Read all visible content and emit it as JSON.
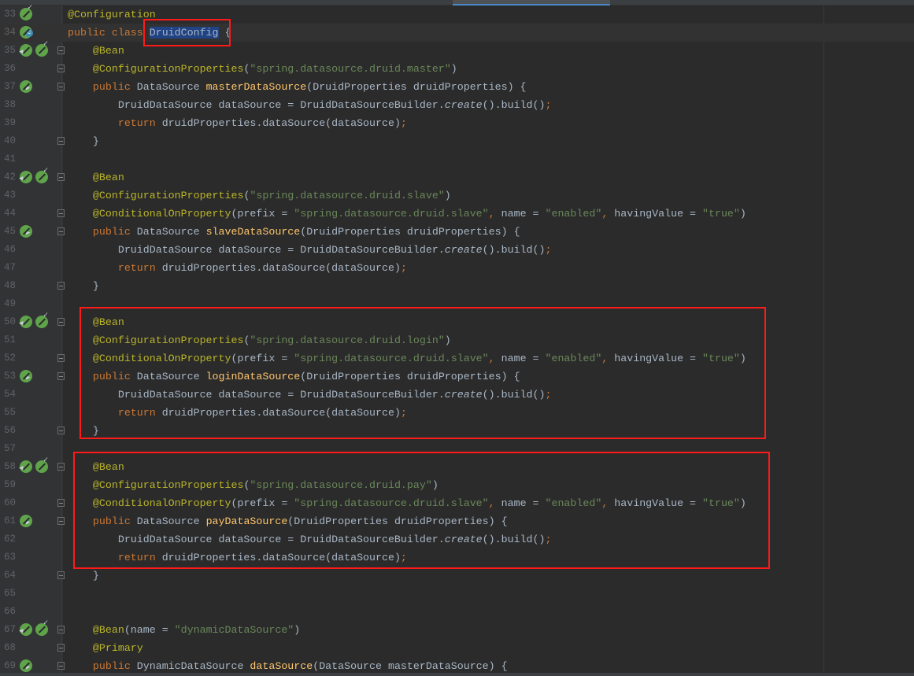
{
  "colors": {
    "keyword": "#cc7832",
    "annotation": "#bbb529",
    "string": "#6a8759",
    "text": "#a9b7c6",
    "method": "#ffc66d",
    "highlight_box": "#ff1a1a",
    "selection": "#214283"
  },
  "lines": [
    {
      "n": "33",
      "icons": [
        "bean-check"
      ],
      "fold": false,
      "tokens": [
        [
          "a",
          "@Configuration"
        ]
      ]
    },
    {
      "n": "34",
      "icons": [
        "bean-class"
      ],
      "fold": false,
      "current": true,
      "tokens": [
        [
          "k",
          "public class "
        ],
        [
          "sel",
          "DruidConfig"
        ],
        [
          "t",
          " {"
        ]
      ]
    },
    {
      "n": "35",
      "icons": [
        "bean-left",
        "bean-check"
      ],
      "fold": true,
      "tokens": [
        [
          "t",
          "    "
        ],
        [
          "a",
          "@Bean"
        ]
      ]
    },
    {
      "n": "36",
      "icons": [],
      "fold": true,
      "tokens": [
        [
          "t",
          "    "
        ],
        [
          "a",
          "@ConfigurationProperties"
        ],
        [
          "t",
          "("
        ],
        [
          "s",
          "\"spring.datasource.druid.master\""
        ],
        [
          "t",
          ")"
        ]
      ]
    },
    {
      "n": "37",
      "icons": [
        "bean-right"
      ],
      "fold": true,
      "tokens": [
        [
          "t",
          "    "
        ],
        [
          "k",
          "public "
        ],
        [
          "t",
          "DataSource "
        ],
        [
          "m",
          "masterDataSource"
        ],
        [
          "t",
          "(DruidProperties druidProperties) {"
        ]
      ]
    },
    {
      "n": "38",
      "icons": [],
      "fold": false,
      "tokens": [
        [
          "t",
          "        DruidDataSource dataSource = DruidDataSourceBuilder."
        ],
        [
          "i",
          "create"
        ],
        [
          "t",
          "().build()"
        ],
        [
          "k",
          ";"
        ]
      ]
    },
    {
      "n": "39",
      "icons": [],
      "fold": false,
      "tokens": [
        [
          "t",
          "        "
        ],
        [
          "k",
          "return "
        ],
        [
          "t",
          "druidProperties.dataSource(dataSource)"
        ],
        [
          "k",
          ";"
        ]
      ]
    },
    {
      "n": "40",
      "icons": [],
      "fold": true,
      "tokens": [
        [
          "t",
          "    }"
        ]
      ]
    },
    {
      "n": "41",
      "icons": [],
      "fold": false,
      "tokens": []
    },
    {
      "n": "42",
      "icons": [
        "bean-left",
        "bean-check"
      ],
      "fold": true,
      "tokens": [
        [
          "t",
          "    "
        ],
        [
          "a",
          "@Bean"
        ]
      ]
    },
    {
      "n": "43",
      "icons": [],
      "fold": false,
      "tokens": [
        [
          "t",
          "    "
        ],
        [
          "a",
          "@ConfigurationProperties"
        ],
        [
          "t",
          "("
        ],
        [
          "s",
          "\"spring.datasource.druid.slave\""
        ],
        [
          "t",
          ")"
        ]
      ]
    },
    {
      "n": "44",
      "icons": [],
      "fold": true,
      "tokens": [
        [
          "t",
          "    "
        ],
        [
          "a",
          "@ConditionalOnProperty"
        ],
        [
          "t",
          "(prefix = "
        ],
        [
          "s",
          "\"spring.datasource.druid.slave\""
        ],
        [
          "k",
          ", "
        ],
        [
          "t",
          "name = "
        ],
        [
          "s",
          "\"enabled\""
        ],
        [
          "k",
          ", "
        ],
        [
          "t",
          "havingValue = "
        ],
        [
          "s",
          "\"true\""
        ],
        [
          "t",
          ")"
        ]
      ]
    },
    {
      "n": "45",
      "icons": [
        "bean-right"
      ],
      "fold": true,
      "tokens": [
        [
          "t",
          "    "
        ],
        [
          "k",
          "public "
        ],
        [
          "t",
          "DataSource "
        ],
        [
          "m",
          "slaveDataSource"
        ],
        [
          "t",
          "(DruidProperties druidProperties) {"
        ]
      ]
    },
    {
      "n": "46",
      "icons": [],
      "fold": false,
      "tokens": [
        [
          "t",
          "        DruidDataSource dataSource = DruidDataSourceBuilder."
        ],
        [
          "i",
          "create"
        ],
        [
          "t",
          "().build()"
        ],
        [
          "k",
          ";"
        ]
      ]
    },
    {
      "n": "47",
      "icons": [],
      "fold": false,
      "tokens": [
        [
          "t",
          "        "
        ],
        [
          "k",
          "return "
        ],
        [
          "t",
          "druidProperties.dataSource(dataSource)"
        ],
        [
          "k",
          ";"
        ]
      ]
    },
    {
      "n": "48",
      "icons": [],
      "fold": true,
      "tokens": [
        [
          "t",
          "    }"
        ]
      ]
    },
    {
      "n": "49",
      "icons": [],
      "fold": false,
      "tokens": []
    },
    {
      "n": "50",
      "icons": [
        "bean-left",
        "bean-check"
      ],
      "fold": true,
      "tokens": [
        [
          "t",
          "    "
        ],
        [
          "a",
          "@Bean"
        ]
      ]
    },
    {
      "n": "51",
      "icons": [],
      "fold": false,
      "tokens": [
        [
          "t",
          "    "
        ],
        [
          "a",
          "@ConfigurationProperties"
        ],
        [
          "t",
          "("
        ],
        [
          "s",
          "\"spring.datasource.druid.login\""
        ],
        [
          "t",
          ")"
        ]
      ]
    },
    {
      "n": "52",
      "icons": [],
      "fold": true,
      "tokens": [
        [
          "t",
          "    "
        ],
        [
          "a",
          "@ConditionalOnProperty"
        ],
        [
          "t",
          "(prefix = "
        ],
        [
          "s",
          "\"spring.datasource.druid.slave\""
        ],
        [
          "k",
          ", "
        ],
        [
          "t",
          "name = "
        ],
        [
          "s",
          "\"enabled\""
        ],
        [
          "k",
          ", "
        ],
        [
          "t",
          "havingValue = "
        ],
        [
          "s",
          "\"true\""
        ],
        [
          "t",
          ")"
        ]
      ]
    },
    {
      "n": "53",
      "icons": [
        "bean-right"
      ],
      "fold": true,
      "tokens": [
        [
          "t",
          "    "
        ],
        [
          "k",
          "public "
        ],
        [
          "t",
          "DataSource "
        ],
        [
          "m",
          "loginDataSource"
        ],
        [
          "t",
          "(DruidProperties druidProperties) {"
        ]
      ]
    },
    {
      "n": "54",
      "icons": [],
      "fold": false,
      "tokens": [
        [
          "t",
          "        DruidDataSource dataSource = DruidDataSourceBuilder."
        ],
        [
          "i",
          "create"
        ],
        [
          "t",
          "().build()"
        ],
        [
          "k",
          ";"
        ]
      ]
    },
    {
      "n": "55",
      "icons": [],
      "fold": false,
      "tokens": [
        [
          "t",
          "        "
        ],
        [
          "k",
          "return "
        ],
        [
          "t",
          "druidProperties.dataSource(dataSource)"
        ],
        [
          "k",
          ";"
        ]
      ]
    },
    {
      "n": "56",
      "icons": [],
      "fold": true,
      "tokens": [
        [
          "t",
          "    }"
        ]
      ]
    },
    {
      "n": "57",
      "icons": [],
      "fold": false,
      "tokens": []
    },
    {
      "n": "58",
      "icons": [
        "bean-left",
        "bean-check"
      ],
      "fold": true,
      "tokens": [
        [
          "t",
          "    "
        ],
        [
          "a",
          "@Bean"
        ]
      ]
    },
    {
      "n": "59",
      "icons": [],
      "fold": false,
      "tokens": [
        [
          "t",
          "    "
        ],
        [
          "a",
          "@ConfigurationProperties"
        ],
        [
          "t",
          "("
        ],
        [
          "s",
          "\"spring.datasource.druid.pay\""
        ],
        [
          "t",
          ")"
        ]
      ]
    },
    {
      "n": "60",
      "icons": [],
      "fold": true,
      "tokens": [
        [
          "t",
          "    "
        ],
        [
          "a",
          "@ConditionalOnProperty"
        ],
        [
          "t",
          "(prefix = "
        ],
        [
          "s",
          "\"spring.datasource.druid.slave\""
        ],
        [
          "k",
          ", "
        ],
        [
          "t",
          "name = "
        ],
        [
          "s",
          "\"enabled\""
        ],
        [
          "k",
          ", "
        ],
        [
          "t",
          "havingValue = "
        ],
        [
          "s",
          "\"true\""
        ],
        [
          "t",
          ")"
        ]
      ]
    },
    {
      "n": "61",
      "icons": [
        "bean-right"
      ],
      "fold": true,
      "tokens": [
        [
          "t",
          "    "
        ],
        [
          "k",
          "public "
        ],
        [
          "t",
          "DataSource "
        ],
        [
          "m",
          "payDataSource"
        ],
        [
          "t",
          "(DruidProperties druidProperties) {"
        ]
      ]
    },
    {
      "n": "62",
      "icons": [],
      "fold": false,
      "tokens": [
        [
          "t",
          "        DruidDataSource dataSource = DruidDataSourceBuilder."
        ],
        [
          "i",
          "create"
        ],
        [
          "t",
          "().build()"
        ],
        [
          "k",
          ";"
        ]
      ]
    },
    {
      "n": "63",
      "icons": [],
      "fold": false,
      "tokens": [
        [
          "t",
          "        "
        ],
        [
          "k",
          "return "
        ],
        [
          "t",
          "druidProperties.dataSource(dataSource)"
        ],
        [
          "k",
          ";"
        ]
      ]
    },
    {
      "n": "64",
      "icons": [],
      "fold": true,
      "tokens": [
        [
          "t",
          "    }"
        ]
      ]
    },
    {
      "n": "65",
      "icons": [],
      "fold": false,
      "tokens": []
    },
    {
      "n": "66",
      "icons": [],
      "fold": false,
      "tokens": []
    },
    {
      "n": "67",
      "icons": [
        "bean-left",
        "bean-check"
      ],
      "fold": true,
      "tokens": [
        [
          "t",
          "    "
        ],
        [
          "a",
          "@Bean"
        ],
        [
          "t",
          "(name = "
        ],
        [
          "s",
          "\"dynamicDataSource\""
        ],
        [
          "t",
          ")"
        ]
      ]
    },
    {
      "n": "68",
      "icons": [],
      "fold": true,
      "tokens": [
        [
          "t",
          "    "
        ],
        [
          "a",
          "@Primary"
        ]
      ]
    },
    {
      "n": "69",
      "icons": [
        "bean-right"
      ],
      "fold": true,
      "tokens": [
        [
          "t",
          "    "
        ],
        [
          "k",
          "public "
        ],
        [
          "t",
          "DynamicDataSource "
        ],
        [
          "m",
          "dataSource"
        ],
        [
          "t",
          "(DataSource masterDataSource) {"
        ]
      ]
    }
  ]
}
